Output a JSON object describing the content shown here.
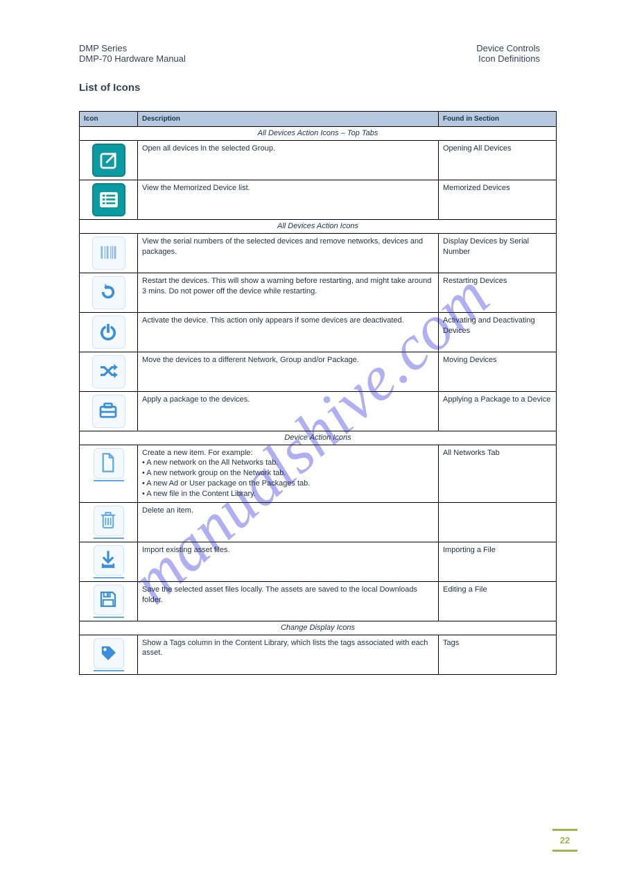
{
  "header": {
    "left_line1": "DMP Series",
    "left_line2": "DMP-70 Hardware Manual",
    "right_line1": "Device Controls",
    "right_line2": "Icon Definitions"
  },
  "doc_title": "List of Icons",
  "watermark": "manualshive.com",
  "page_number": "22",
  "columns": {
    "c1": "Icon",
    "c2": "Description",
    "c3": "Found in Section"
  },
  "sections": [
    {
      "title": "All Devices Action Icons – Top Tabs",
      "rows": [
        {
          "icon": "open-external",
          "style": "teal",
          "desc": "Open all devices in the selected Group.",
          "link": "Opening All Devices"
        },
        {
          "icon": "list",
          "style": "teal",
          "desc": "View the Memorized Device list.",
          "link": "Memorized Devices"
        }
      ]
    },
    {
      "title": "All Devices Action Icons",
      "rows": [
        {
          "icon": "barcode",
          "style": "light",
          "desc": "View the serial numbers of the selected devices and remove networks, devices and packages.",
          "link": "Display Devices by Serial Number"
        },
        {
          "icon": "refresh",
          "style": "light",
          "desc": "Restart the devices. This will show a warning before restarting, and might take around 3 mins. Do not power off the device while restarting.",
          "link": "Restarting Devices"
        },
        {
          "icon": "power",
          "style": "light",
          "desc": "Activate the device. This action only appears if some devices are deactivated.",
          "link": "Activating and Deactivating Devices"
        },
        {
          "icon": "shuffle",
          "style": "light",
          "desc": "Move the devices to a different Network, Group and/or Package.",
          "link": "Moving Devices"
        },
        {
          "icon": "briefcase",
          "style": "light",
          "desc": "Apply a package to the devices.",
          "link": "Applying a Package to a Device"
        }
      ]
    },
    {
      "title": "Device Action Icons",
      "rows": [
        {
          "icon": "file",
          "style": "light",
          "desc_lines": [
            "Create a new item. For example:",
            "• A new network on the All Networks tab.",
            "• A new network group on the Network tab.",
            "• A new Ad or User package on the Packages tab.",
            "• A new file in the Content Library."
          ],
          "link": "All Networks Tab"
        },
        {
          "icon": "trash",
          "style": "light",
          "desc": "Delete an item.",
          "link": ""
        },
        {
          "icon": "download",
          "style": "light",
          "desc": "Import existing asset files.",
          "link": "Importing a File"
        },
        {
          "icon": "save",
          "style": "light",
          "desc": "Save the selected asset files locally. The assets are saved to the local Downloads folder.",
          "link": "Editing a File"
        }
      ]
    },
    {
      "title": "Change Display Icons",
      "rows": [
        {
          "icon": "tag",
          "style": "light",
          "desc": "Show a Tags column in the Content Library, which lists the tags associated with each asset.",
          "link": "Tags"
        }
      ]
    }
  ]
}
